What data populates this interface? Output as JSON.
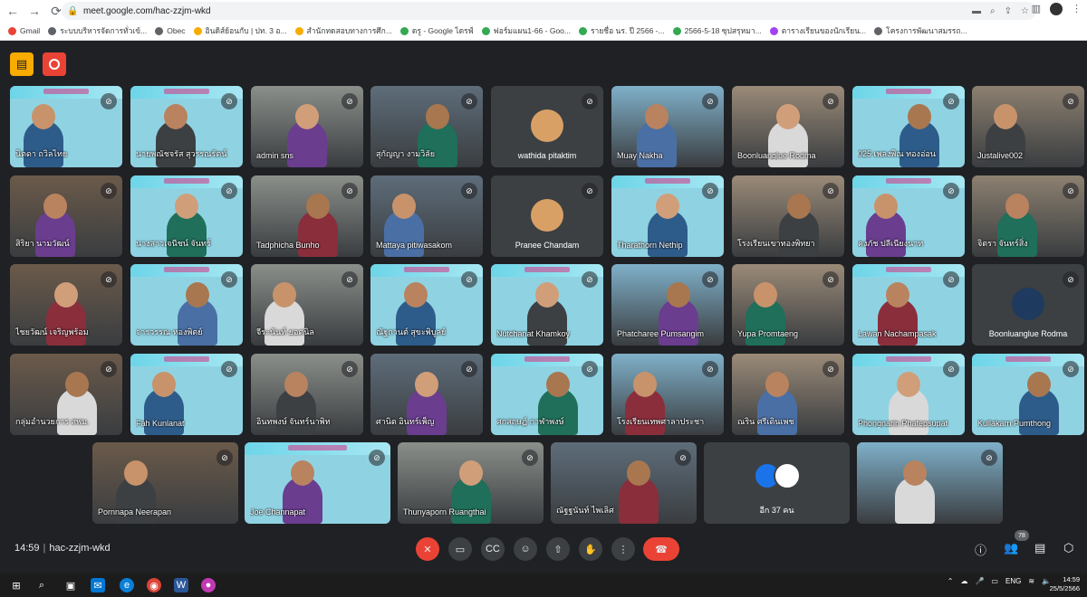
{
  "browser": {
    "url": "meet.google.com/hac-zzjm-wkd",
    "bookmarks": [
      {
        "label": "Gmail",
        "color": "#ea4335"
      },
      {
        "label": "ระบบบริหารจัดการทั่วเข้...",
        "color": "#5f6368"
      },
      {
        "label": "Obec",
        "color": "#5f6368"
      },
      {
        "label": "อินดิส์ย้อนกับ | ปท. 3 อ...",
        "color": "#f9ab00"
      },
      {
        "label": "สำนักทดสอบทางการศึก...",
        "color": "#f9ab00"
      },
      {
        "label": "ดรู - Google ไดรฟ์",
        "color": "#34a853"
      },
      {
        "label": "ฟอร์มแผน1-66 - Goo...",
        "color": "#34a853"
      },
      {
        "label": "รายชื่อ นร. ปี 2566 -...",
        "color": "#34a853"
      },
      {
        "label": "2566-5-18 ซุปสรุหมา...",
        "color": "#34a853"
      },
      {
        "label": "ตารางเรียนของนักเรียน...",
        "color": "#a142f4"
      },
      {
        "label": "โครงการพัฒนาสมรรถ...",
        "color": "#5f6368"
      }
    ]
  },
  "meeting": {
    "time": "14:59",
    "code": "hac-zzjm-wkd",
    "people_count": "78"
  },
  "tiles": [
    {
      "name": "นิตดา ถวิลไทย",
      "cam": true
    },
    {
      "name": "นายพณัชจรัส สุวรรณรัตน์",
      "cam": true
    },
    {
      "name": "admin sns",
      "cam": true
    },
    {
      "name": "สุกัญญา งามวิลัย",
      "cam": true
    },
    {
      "name": "wathida pitaktim",
      "cam": false
    },
    {
      "name": "Muay Nakha",
      "cam": true
    },
    {
      "name": "Boonluanglue Rodma",
      "cam": true
    },
    {
      "name": "025 เพลงพิณ ทองอ่อน",
      "cam": true
    },
    {
      "name": "Justalive002",
      "cam": true
    },
    {
      "name": "สิริยา นามวัฒน์",
      "cam": true
    },
    {
      "name": "นางสาวเจนีชน์ จันทร์",
      "cam": true
    },
    {
      "name": "Tadphicha Bunho",
      "cam": true
    },
    {
      "name": "Mattaya pitiwasakom",
      "cam": true
    },
    {
      "name": "Pranee Chandam",
      "cam": false
    },
    {
      "name": "Tharathorn Nethip",
      "cam": true
    },
    {
      "name": "โรงเรียนเขาทองพิทยา",
      "cam": true
    },
    {
      "name": "คงภัช ปลีเนียงนาท",
      "cam": true
    },
    {
      "name": "จิตรา จันทร์สิ่ง",
      "cam": true
    },
    {
      "name": "ไชยวัฒน์ เจริญพร้อม",
      "cam": true
    },
    {
      "name": "จารวรรณ ทองพิตย์",
      "cam": true
    },
    {
      "name": "จีระนันท์ ยอดนิล",
      "cam": true
    },
    {
      "name": "ณัฐกานต์ สุขะพิบูลย์",
      "cam": true
    },
    {
      "name": "Nutchanat Khamkoy",
      "cam": true
    },
    {
      "name": "Phatcharee Pumsangim",
      "cam": true
    },
    {
      "name": "Yupa Promtaeng",
      "cam": true
    },
    {
      "name": "Lawan Nachampasak",
      "cam": true
    },
    {
      "name": "Boonluanglue Rodma",
      "cam": false
    },
    {
      "name": "กลุ่มอำนวยการ สพม.",
      "cam": true
    },
    {
      "name": "Fah Kunlanat",
      "cam": true
    },
    {
      "name": "อินทพงษ์ จันทร์นาพิท",
      "cam": true
    },
    {
      "name": "ศานิต อินทร์เพ็ญ",
      "cam": true
    },
    {
      "name": "ศกสฤษฏ์ กาฬาพงษ์",
      "cam": true
    },
    {
      "name": "โรงเรียนเทพศาลาประชา",
      "cam": true
    },
    {
      "name": "ณริน ศรีเดินเพช",
      "cam": true
    },
    {
      "name": "Phongnarin Phatepsupat",
      "cam": true
    },
    {
      "name": "Kullakarn Pumthong",
      "cam": true
    },
    {
      "name": "Pornnapa Neerapan",
      "cam": true
    },
    {
      "name": "Joe Channapat",
      "cam": true
    },
    {
      "name": "Thunyaporn Ruangthai",
      "cam": true
    },
    {
      "name": "ณัฐฐนันท์ ไพเลิศ",
      "cam": true
    },
    {
      "name": "อีก 37 คน",
      "cam": false
    },
    {
      "name": "",
      "cam": true
    }
  ],
  "taskbar": {
    "lang": "ENG",
    "clock_time": "14:59",
    "clock_date": "25/5/2566"
  }
}
